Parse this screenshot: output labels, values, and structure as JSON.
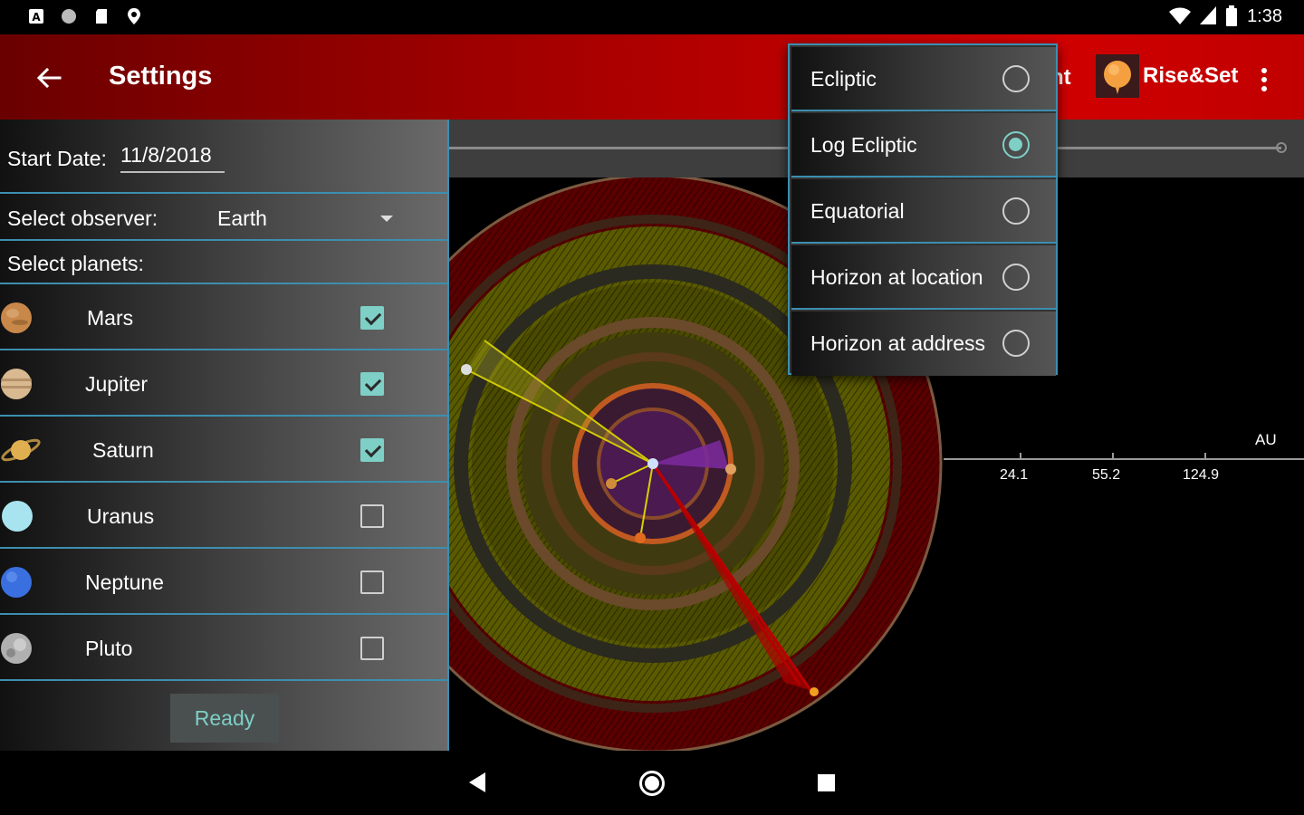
{
  "status_bar": {
    "time": "1:38"
  },
  "app_bar": {
    "title": "Settings",
    "partial_menu_label": "nt",
    "rise_set_label": "Rise&Set"
  },
  "settings": {
    "start_date_label": "Start Date:",
    "start_date_value": "11/8/2018",
    "observer_label": "Select observer:",
    "observer_value": "Earth",
    "planets_label": "Select planets:",
    "planets": [
      {
        "name": "Mars",
        "checked": true,
        "color": "#c8884a"
      },
      {
        "name": "Jupiter",
        "checked": true,
        "color": "#d9b98f"
      },
      {
        "name": "Saturn",
        "checked": true,
        "color": "#e0b050"
      },
      {
        "name": "Uranus",
        "checked": false,
        "color": "#a8e4f0"
      },
      {
        "name": "Neptune",
        "checked": false,
        "color": "#3a6fe0"
      },
      {
        "name": "Pluto",
        "checked": false,
        "color": "#b0b0b0"
      }
    ],
    "ready_label": "Ready"
  },
  "projection_menu": {
    "items": [
      {
        "label": "Ecliptic",
        "selected": false
      },
      {
        "label": "Log Ecliptic",
        "selected": true
      },
      {
        "label": "Equatorial",
        "selected": false
      },
      {
        "label": "Horizon at location",
        "selected": false
      },
      {
        "label": "Horizon at address",
        "selected": false
      }
    ]
  },
  "scale_axis": {
    "unit": "AU",
    "ticks": [
      "24.1",
      "55.2",
      "124.9"
    ]
  },
  "colors": {
    "accent": "#7ecfc6",
    "divider": "#3c8fb0",
    "app_bar": "#c00000"
  }
}
